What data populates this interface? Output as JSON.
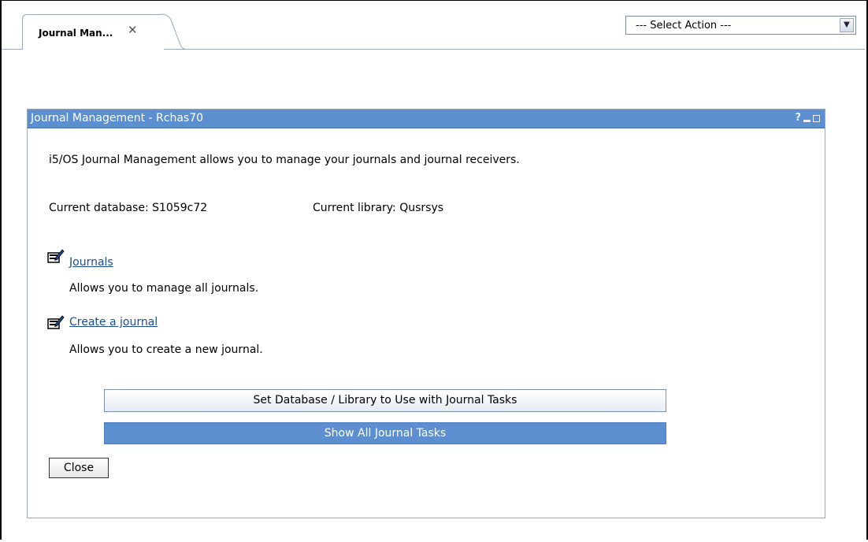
{
  "tabs": [
    {
      "label": "Journal Man...",
      "close_icon": "close-x-icon"
    }
  ],
  "action_select": {
    "selected": "--- Select Action ---",
    "icon": "chevron-down-icon"
  },
  "portlet": {
    "title": "Journal Management - Rchas70",
    "title_icons": {
      "help": "?",
      "minimize": "minimize-icon",
      "maximize": "maximize-icon"
    },
    "description": "i5/OS Journal Management allows you to manage your journals and journal receivers.",
    "current_database": "Current database: S1059c72",
    "current_library": "Current library: Qusrsys",
    "tasks": [
      {
        "icon": "task-edit-icon",
        "link": "Journals",
        "description": "Allows you to manage all journals."
      },
      {
        "icon": "task-edit-icon",
        "link": "Create a journal",
        "description": "Allows you to create a new journal."
      }
    ],
    "set_database_button": "Set Database / Library to Use with Journal Tasks",
    "show_all_button": "Show All Journal Tasks",
    "close_button": "Close"
  },
  "colors": {
    "titlebar": "#5b8fd0",
    "link": "#1a4d9a",
    "border": "#9aa8b8"
  }
}
